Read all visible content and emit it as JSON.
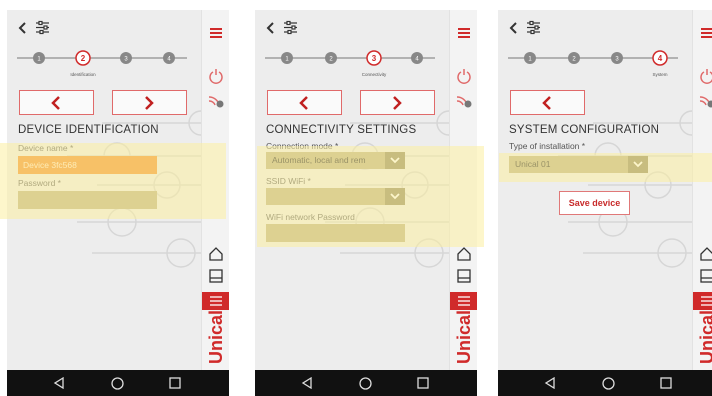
{
  "screens": [
    {
      "step_label": "Identification",
      "section_title": "DEVICE IDENTIFICATION",
      "device_name_label": "Device name *",
      "device_name_value": "Device 3fc568",
      "password_label": "Password *",
      "password_value": ""
    },
    {
      "step_label": "Connectivity",
      "section_title": "CONNECTIVITY SETTINGS",
      "connection_mode_label": "Connection mode *",
      "connection_mode_value": "Automatic, local and rem",
      "ssid_label": "SSID WiFi *",
      "ssid_value": "",
      "wifi_password_label": "WiFi network Password",
      "wifi_password_value": ""
    },
    {
      "step_label": "System",
      "section_title": "SYSTEM CONFIGURATION",
      "installation_type_label": "Type of installation *",
      "installation_type_value": "Unical 01",
      "save_label": "Save device"
    }
  ],
  "steps": [
    "1",
    "2",
    "3",
    "4"
  ],
  "brand": "Unical",
  "colors": {
    "accent": "#d02a2a",
    "olive_field": "#b8ad7f",
    "olive_dark": "#8a8258",
    "active_input": "#f28a23",
    "highlight": "#fcee9f"
  },
  "icons": {
    "back": "chevron-left-icon",
    "filter": "sliders-icon",
    "menu": "hamburger-icon",
    "power": "power-icon",
    "wifi": "wifi-settings-icon",
    "home": "home-icon",
    "save": "save-icon",
    "list": "list-icon",
    "nav_back": "android-back-icon",
    "nav_home": "android-home-icon",
    "nav_recents": "android-recents-icon"
  }
}
